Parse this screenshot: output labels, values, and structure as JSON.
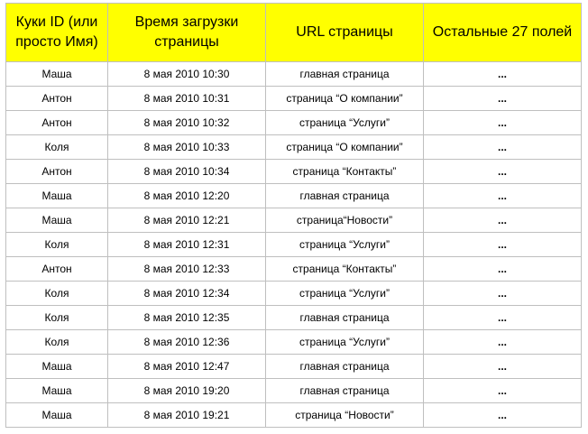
{
  "headers": [
    "Куки ID (или просто Имя)",
    "Время загрузки страницы",
    "URL страницы",
    "Остальные 27 полей"
  ],
  "rows": [
    [
      "Маша",
      "8 мая 2010 10:30",
      "главная страница",
      "..."
    ],
    [
      "Антон",
      "8 мая 2010 10:31",
      "страница “О компании”",
      "..."
    ],
    [
      "Антон",
      "8 мая 2010 10:32",
      "страница “Услуги”",
      "..."
    ],
    [
      "Коля",
      "8 мая 2010 10:33",
      "страница “О компании”",
      "..."
    ],
    [
      "Антон",
      "8 мая 2010 10:34",
      "страница “Контакты”",
      "..."
    ],
    [
      "Маша",
      "8 мая 2010 12:20",
      "главная страница",
      "..."
    ],
    [
      "Маша",
      "8 мая 2010 12:21",
      "страница“Новости”",
      "..."
    ],
    [
      "Коля",
      "8 мая 2010 12:31",
      "страница “Услуги”",
      "..."
    ],
    [
      "Антон",
      "8 мая 2010 12:33",
      "страница “Контакты”",
      "..."
    ],
    [
      "Коля",
      "8 мая 2010 12:34",
      "страница “Услуги”",
      "..."
    ],
    [
      "Коля",
      "8 мая 2010 12:35",
      "главная страница",
      "..."
    ],
    [
      "Коля",
      "8 мая 2010 12:36",
      "страница “Услуги”",
      "..."
    ],
    [
      "Маша",
      "8 мая 2010 12:47",
      "главная страница",
      "..."
    ],
    [
      "Маша",
      "8 мая 2010 19:20",
      "главная страница",
      "..."
    ],
    [
      "Маша",
      "8 мая 2010 19:21",
      "страница “Новости”",
      "..."
    ]
  ]
}
